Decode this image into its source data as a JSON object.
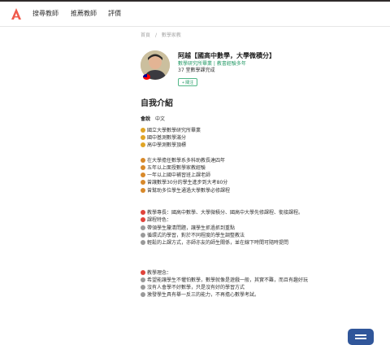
{
  "nav": {
    "logo": "A",
    "links": [
      "搜尋教師",
      "推薦教師",
      "評價"
    ]
  },
  "breadcrumb": [
    "首頁",
    "/",
    "數學家教"
  ],
  "teacher": {
    "name": "阿越【國高中數學，大學微積分】",
    "subtitle": "數學研究所畢業 | 教書經驗多年",
    "lessons": "37 堂數學課完成",
    "follow": "+ 關注"
  },
  "intro": {
    "heading": "自我介紹",
    "language_label": "會說",
    "language_value": "中文",
    "lines": [
      {
        "icon": "trophy",
        "text": "國立大學數學研究所畢業"
      },
      {
        "icon": "trophy",
        "text": "國中基測數學滿分"
      },
      {
        "icon": "trophy",
        "text": "高中學測數學頂標"
      },
      {
        "icon": "",
        "text": ""
      },
      {
        "icon": "medal",
        "text": "在大學擔任數學系多科助教長達四年"
      },
      {
        "icon": "medal",
        "text": "五年以上面授數學家教經驗"
      },
      {
        "icon": "medal",
        "text": "一年以上國中補習班上課老師"
      },
      {
        "icon": "medal",
        "text": "曾讓數學30分的學生進步到大考80分"
      },
      {
        "icon": "medal",
        "text": "曾幫助多位學生通過大學數學必修課程"
      },
      {
        "icon": "",
        "text": ""
      },
      {
        "icon": "",
        "text": ""
      },
      {
        "icon": "pin",
        "text": "教學專長：國高中數學、大學微積分、國高中大學先修課程、銜接課程。"
      },
      {
        "icon": "pin",
        "text": "課程特色："
      },
      {
        "icon": "dot",
        "text": "帶領學生釐清問題，讓學生抓過抓到重點"
      },
      {
        "icon": "dot",
        "text": "循環式的學習，對於不同程度的學生調整教法"
      },
      {
        "icon": "dot",
        "text": "輕鬆的上課方式，亦師亦友的師生關係，並在線下時間可隨時提問"
      },
      {
        "icon": "",
        "text": ""
      },
      {
        "icon": "",
        "text": ""
      },
      {
        "icon": "",
        "text": ""
      },
      {
        "icon": "pin",
        "text": "教學理念："
      },
      {
        "icon": "dot",
        "text": "希望能讓學生不懼怕數學，數學就像是遊戲一般，其實不難，而且有趣好玩"
      },
      {
        "icon": "dot",
        "text": "沒有人會學不好數學，只是沒有好的學習方式"
      },
      {
        "icon": "dot",
        "text": "激發學生具有舉一反三的能力，不再擔心數學考試。"
      }
    ]
  },
  "colors": {
    "trophy": "#e0a526",
    "medal": "#d8892a",
    "pin": "#e0433b",
    "dot": "#9a9a9a",
    "accent": "#2a9c6a",
    "logo": "#f05a4b",
    "chat": "#30569a"
  }
}
